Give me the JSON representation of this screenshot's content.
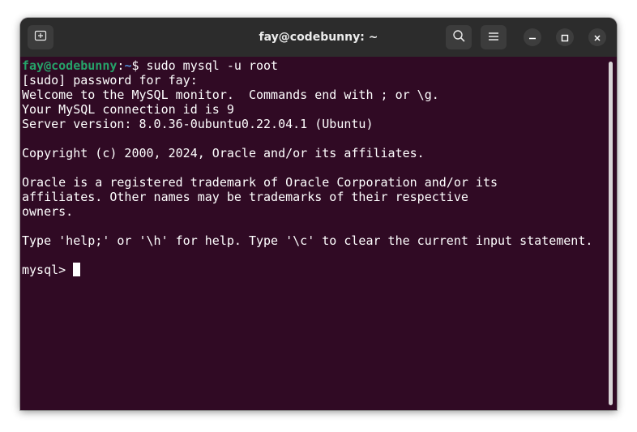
{
  "window": {
    "title": "fay@codebunny: ~",
    "background_color": "#300a24",
    "titlebar_color": "#2c2c2c"
  },
  "titlebar": {
    "left_buttons": [
      {
        "icon": "new-tab-icon"
      }
    ],
    "right_buttons": [
      {
        "icon": "search-icon"
      },
      {
        "icon": "hamburger-menu-icon"
      }
    ],
    "window_controls": [
      {
        "icon": "minimize-icon"
      },
      {
        "icon": "maximize-icon"
      },
      {
        "icon": "close-icon"
      }
    ]
  },
  "terminal": {
    "prompt": {
      "user_host": "fay@codebunny",
      "separator": ":",
      "path": "~",
      "symbol": "$",
      "command": " sudo mysql -u root",
      "user_color": "#26a269",
      "path_color": "#4f8ad3"
    },
    "output_lines": [
      "[sudo] password for fay:",
      "Welcome to the MySQL monitor.  Commands end with ; or \\g.",
      "Your MySQL connection id is 9",
      "Server version: 8.0.36-0ubuntu0.22.04.1 (Ubuntu)",
      "",
      "Copyright (c) 2000, 2024, Oracle and/or its affiliates.",
      "",
      "Oracle is a registered trademark of Oracle Corporation and/or its",
      "affiliates. Other names may be trademarks of their respective",
      "owners.",
      "",
      "Type 'help;' or '\\h' for help. Type '\\c' to clear the current input statement.",
      ""
    ],
    "mysql_prompt": "mysql> "
  }
}
